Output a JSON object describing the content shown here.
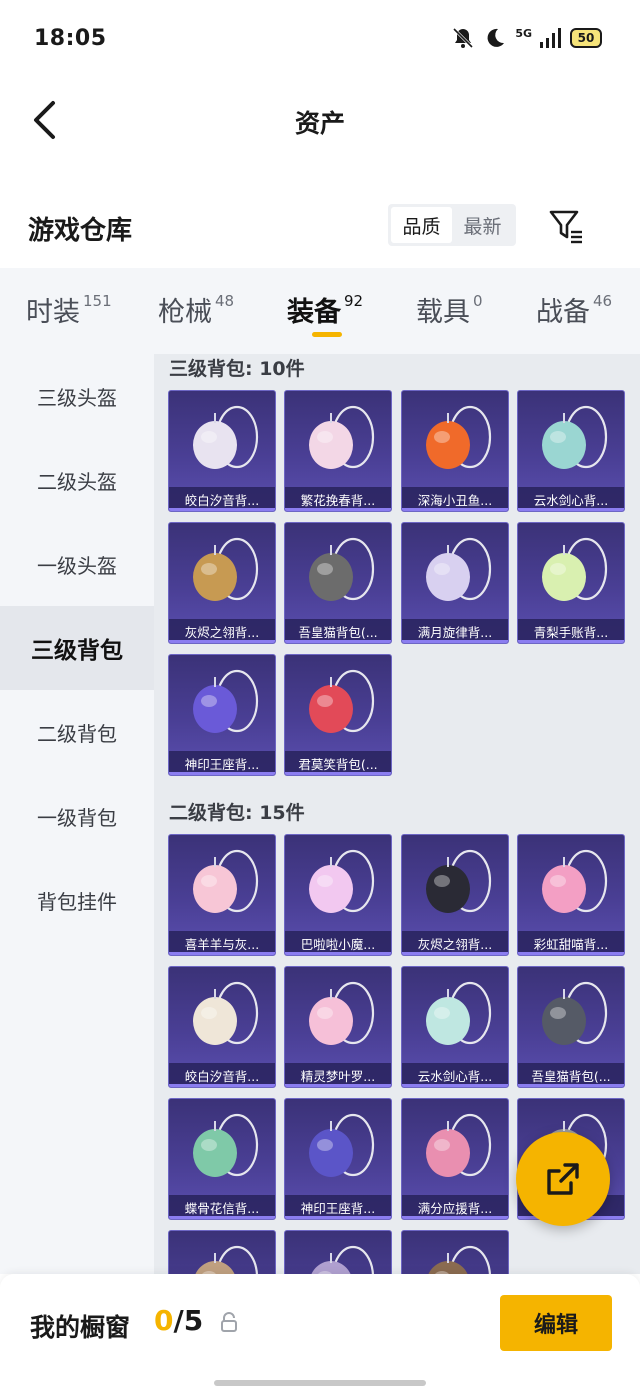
{
  "status_bar": {
    "time": "18:05",
    "network": "5G",
    "battery": "50"
  },
  "header": {
    "title": "资产"
  },
  "section": {
    "title": "游戏仓库",
    "sort_options": [
      "品质",
      "最新"
    ],
    "active_sort": 0
  },
  "tabs": [
    {
      "label": "时装",
      "count": "151"
    },
    {
      "label": "枪械",
      "count": "48"
    },
    {
      "label": "装备",
      "count": "92"
    },
    {
      "label": "载具",
      "count": "0"
    },
    {
      "label": "战备",
      "count": "46"
    }
  ],
  "sidebar": [
    "三级头盔",
    "二级头盔",
    "一级头盔",
    "三级背包",
    "二级背包",
    "一级背包",
    "背包挂件"
  ],
  "groups": [
    {
      "title": "三级背包: 10件",
      "items": [
        "皎白汐音背...",
        "繁花挽春背...",
        "深海小丑鱼...",
        "云水剑心背...",
        "灰烬之翎背...",
        "吾皇猫背包(...",
        "满月旋律背...",
        "青梨手账背...",
        "神印王座背...",
        "君莫笑背包(..."
      ]
    },
    {
      "title": "二级背包: 15件",
      "items": [
        "喜羊羊与灰...",
        "巴啦啦小魔...",
        "灰烬之翎背...",
        "彩虹甜喵背...",
        "皎白汐音背...",
        "精灵梦叶罗...",
        "云水剑心背...",
        "吾皇猫背包(...",
        "蝶骨花信背...",
        "神印王座背...",
        "满分应援背...",
        "...",
        "",
        "",
        ""
      ]
    }
  ],
  "bottom_bar": {
    "label": "我的橱窗",
    "current": "0",
    "total": "/5",
    "edit_label": "编辑"
  },
  "colors": {
    "accent": "#f5b400",
    "card_bg": "#4a3f95"
  }
}
